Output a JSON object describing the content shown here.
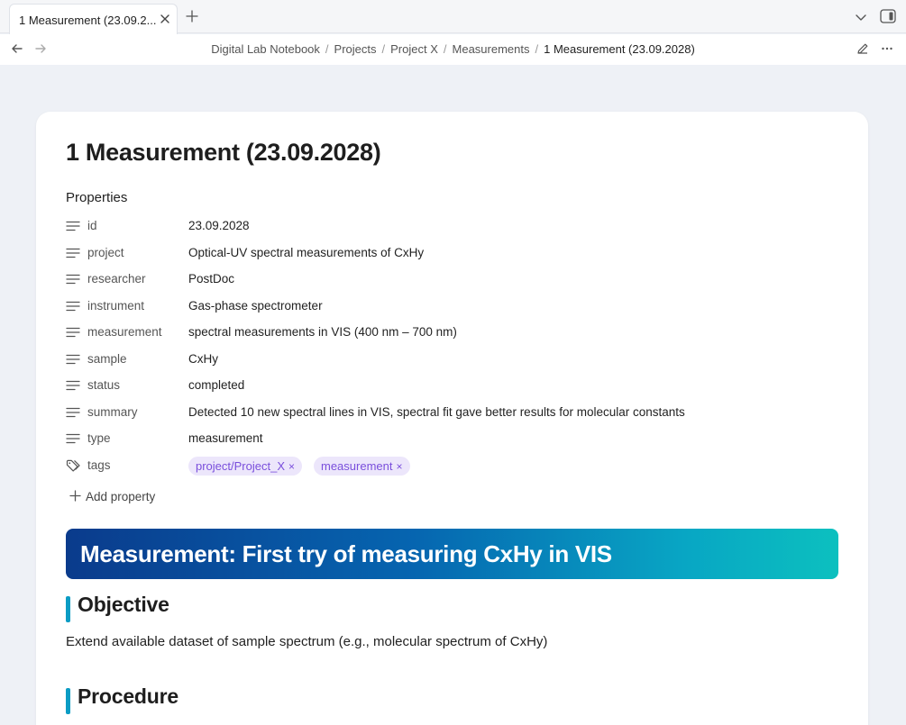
{
  "tab": {
    "title": "1 Measurement (23.09.2..."
  },
  "breadcrumb": {
    "items": [
      "Digital Lab Notebook",
      "Projects",
      "Project X",
      "Measurements"
    ],
    "current": "1 Measurement (23.09.2028)",
    "separator": "/"
  },
  "note": {
    "title": "1 Measurement (23.09.2028)",
    "properties_heading": "Properties",
    "properties": [
      {
        "key": "id",
        "value": "23.09.2028",
        "icon": "text-lines-icon"
      },
      {
        "key": "project",
        "value": "Optical-UV spectral measurements of CxHy",
        "icon": "text-lines-icon"
      },
      {
        "key": "researcher",
        "value": "PostDoc",
        "icon": "text-lines-icon"
      },
      {
        "key": "instrument",
        "value": "Gas-phase spectrometer",
        "icon": "text-lines-icon"
      },
      {
        "key": "measurement",
        "value": "spectral measurements in VIS (400 nm – 700 nm)",
        "icon": "text-lines-icon"
      },
      {
        "key": "sample",
        "value": "CxHy",
        "icon": "text-lines-icon"
      },
      {
        "key": "status",
        "value": "completed",
        "icon": "text-lines-icon"
      },
      {
        "key": "summary",
        "value": "Detected 10 new spectral lines in VIS, spectral fit gave better results for molecular constants",
        "icon": "text-lines-icon"
      },
      {
        "key": "type",
        "value": "measurement",
        "icon": "text-lines-icon"
      }
    ],
    "tags": {
      "key": "tags",
      "icon": "tag-icon",
      "values": [
        "project/Project_X",
        "measurement"
      ],
      "remove_glyph": "×"
    },
    "add_property_label": "Add property",
    "banner": "Measurement: First try of measuring CxHy in VIS",
    "sections": [
      {
        "title": "Objective",
        "text": "Extend available dataset of sample spectrum (e.g., molecular spectrum of CxHy)"
      },
      {
        "title": "Procedure"
      }
    ]
  },
  "colors": {
    "tag_bg": "#ece6fb",
    "tag_text": "#7a4fdc",
    "section_accent": "#0b9cc4",
    "banner_start": "#0a3b8c",
    "banner_end": "#0cc0bf"
  }
}
